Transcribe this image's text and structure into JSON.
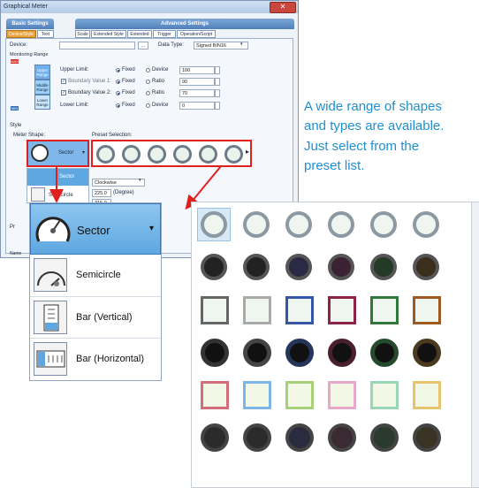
{
  "dialog": {
    "title": "Graphical Meter",
    "close_label": "✕",
    "tab_groups": [
      "Basic Settings",
      "Advanced Settings"
    ],
    "subtabs": [
      "Device/Style",
      "Text",
      "Scale",
      "Extended Style",
      "Extended",
      "Trigger",
      "Operation/Script"
    ],
    "active_subtab": "Device/Style",
    "device_label": "Device:",
    "device_value": "",
    "browse_label": "...",
    "data_type_label": "Data Type:",
    "data_type_value": "Signed BIN16",
    "monitoring_range_label": "Monitoring Range",
    "range_max": "MAX",
    "range_min": "MIN",
    "ranges": [
      "Upper Range",
      "Middle Range",
      "Lower Range"
    ],
    "limits": [
      {
        "label": "Upper Limit:",
        "checkbox": false,
        "value": "100",
        "selected": "Fixed",
        "alt": "Device"
      },
      {
        "label": "Boundary Value 1:",
        "checkbox": true,
        "value": "90",
        "selected": "Fixed",
        "alt": "Ratio"
      },
      {
        "label": "Boundary Value 2:",
        "checkbox": true,
        "value": "70",
        "selected": "Fixed",
        "alt": "Ratio"
      },
      {
        "label": "Lower Limit:",
        "checkbox": false,
        "value": "0",
        "selected": "Fixed",
        "alt": "Device"
      }
    ],
    "fixed_label": "Fixed",
    "style_label": "Style",
    "meter_shape_label": "Meter Shape:",
    "meter_shape_value": "Sector",
    "preset_label": "Preset Selection:",
    "direction_value": "Clockwise",
    "angle1": "225.0",
    "angle2": "315.0",
    "degree_label": "(Degree)",
    "small_options": [
      "Sector",
      "Semicircle"
    ],
    "left_stub_1": "Pr",
    "left_stub_2": "Name"
  },
  "callout": {
    "lines": [
      "A wide range of shapes",
      "and types are available.",
      "Just select from the",
      "preset list."
    ]
  },
  "shape_dropdown": {
    "selected": "Sector",
    "options": [
      "Semicircle",
      "Bar (Vertical)",
      "Bar (Horizontal)"
    ]
  },
  "colors": {
    "accent_red": "#e0201f",
    "callout_blue": "#1f8fd2",
    "selection_blue": "#5ea7e0"
  }
}
